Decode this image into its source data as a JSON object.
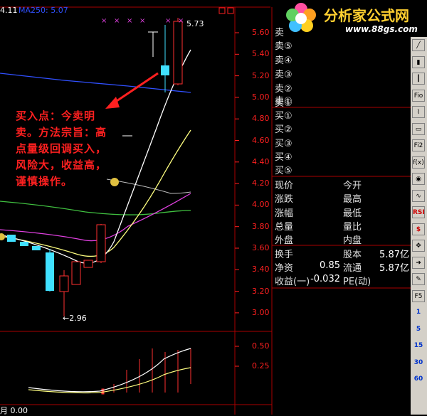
{
  "header": {
    "ma_partial": "4.11",
    "ma250_label": "MA250: 5.07",
    "high_price_marker": "5.73",
    "low_price_marker": "←2.96"
  },
  "price_axis": [
    "5.60",
    "5.40",
    "5.20",
    "5.00",
    "4.80",
    "4.60",
    "4.40",
    "4.20",
    "4.00",
    "3.80",
    "3.60",
    "3.40",
    "3.20",
    "3.00"
  ],
  "volume_axis": [
    "0.50",
    "0.25"
  ],
  "footer": {
    "value": "月 0.00"
  },
  "annotation": "买入点：今卖明卖。方法宗旨：高点量级回调买入，风险大，收益高，谨慎操作。",
  "logo": {
    "title": "分析家公式网",
    "url": "www.88gs.com"
  },
  "orderbook": {
    "sell": [
      "卖⑤",
      "卖④",
      "卖③",
      "卖②",
      "卖①"
    ],
    "sell_top": "卖",
    "buy": [
      "买①",
      "买②",
      "买③",
      "买④",
      "买⑤"
    ]
  },
  "quote": {
    "rows": [
      {
        "l1": "现价",
        "v1": "",
        "l2": "今开",
        "v2": ""
      },
      {
        "l1": "涨跌",
        "v1": "",
        "l2": "最高",
        "v2": ""
      },
      {
        "l1": "涨幅",
        "v1": "",
        "l2": "最低",
        "v2": ""
      },
      {
        "l1": "总量",
        "v1": "",
        "l2": "量比",
        "v2": ""
      },
      {
        "l1": "外盘",
        "v1": "",
        "l2": "内盘",
        "v2": ""
      }
    ],
    "rows2": [
      {
        "l1": "换手",
        "v1": "",
        "l2": "股本",
        "v2": "5.87亿"
      },
      {
        "l1": "净资",
        "v1": "0.85",
        "l2": "流通",
        "v2": "5.87亿"
      },
      {
        "l1": "收益(一)",
        "v1": "-0.032",
        "l2": "PE(动)",
        "v2": ""
      }
    ]
  },
  "toolbar": [
    "Fio",
    "Fi2",
    "RSI",
    "F5",
    "1",
    "5",
    "15",
    "30",
    "60"
  ],
  "colors": {
    "axis_red": "#ff2020",
    "up_red": "#ff3030",
    "down_cyan": "#40e0ff",
    "ma_white": "#ffffff",
    "ma_yellow": "#ffff80",
    "ma_magenta": "#e040e0",
    "ma_green": "#40c040",
    "ma_blue": "#2040ff"
  }
}
